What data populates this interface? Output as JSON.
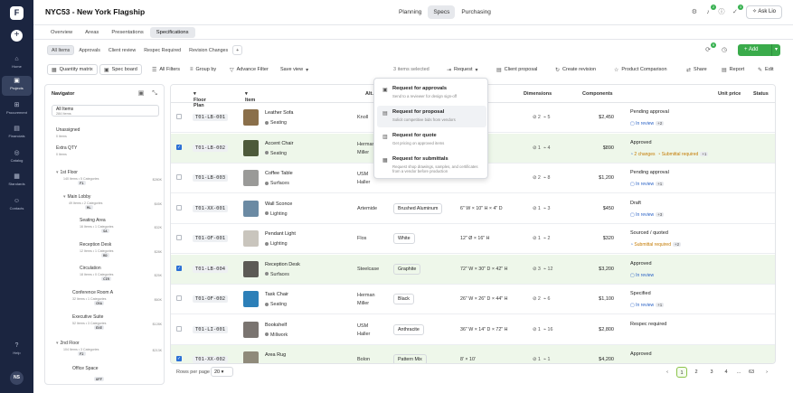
{
  "app": {
    "project_title": "NYC53 - New York Flagship",
    "tabs": [
      "Planning",
      "Specs",
      "Purchasing"
    ],
    "ask": "Ask Lio"
  },
  "rail": {
    "items": [
      "Home",
      "Projects",
      "Procurement",
      "Financials",
      "Catalog",
      "Standards",
      "Contacts"
    ],
    "help": "Help",
    "avatar": "NS"
  },
  "subtabs": [
    "Overview",
    "Areas",
    "Presentations",
    "Specifications"
  ],
  "filter_tabs": [
    "All Items",
    "Approvals",
    "Client review",
    "Respec Required",
    "Revision Changes",
    "+"
  ],
  "add_label": "+ Add",
  "badges": {
    "h1": "2",
    "h2": "3",
    "sync": "8"
  },
  "toolbar": {
    "quantity": "Quantity matrix",
    "spec_board": "Spec board",
    "all_filters": "All Filters",
    "group_by": "Group by",
    "advance_filter": "Advance Filter",
    "save_view": "Save view",
    "selected": "3 items selected",
    "request": "Request",
    "client_proposal": "Client proposal",
    "create_revision": "Create revision",
    "product_comparison": "Product Comparison",
    "share": "Share",
    "report": "Report",
    "edit": "Edit"
  },
  "navigator": {
    "title": "Navigator",
    "all_items": "All Items",
    "all_count": "284 Items",
    "unassigned": "Unassigned",
    "unassigned_count": "0 Items",
    "extra": "Extra QTY",
    "extra_count": "0 Items",
    "nodes": [
      {
        "code": "F1",
        "name": "1st Floor",
        "meta": "140 Items  •  5 Categories",
        "amount": "$280K"
      },
      {
        "code": "ML",
        "name": "Main Lobby",
        "meta": "49 Items  •  2 Categories",
        "amount": "$45K"
      },
      {
        "code": "SA",
        "name": "Seating Area",
        "meta": "16 Items  •  1 Categories",
        "amount": "$32K"
      },
      {
        "code": "RD",
        "name": "Reception Desk",
        "meta": "12 Items  •  1 Categories",
        "amount": "$28K"
      },
      {
        "code": "CIR",
        "name": "Circulation",
        "meta": "18 Items  •  0 Categories",
        "amount": "$25K"
      },
      {
        "code": "CRA",
        "name": "Conference Room A",
        "meta": "32 Items  •  1 Categories",
        "amount": "$60K"
      },
      {
        "code": "EXE",
        "name": "Executive Suite",
        "meta": "52 Items  •  3 Categories",
        "amount": "$128K"
      },
      {
        "code": "F2",
        "name": "2nd Floor",
        "meta": "104 Items  •  3 Categories",
        "amount": "$213K"
      },
      {
        "code": "OFF",
        "name": "Office Space",
        "meta": "",
        "amount": ""
      }
    ]
  },
  "columns": [
    "Floor Plan",
    "Item",
    "Alt.",
    "Dimensions",
    "Components",
    "Unit price",
    "Status"
  ],
  "rows": [
    {
      "checked": false,
      "code": "T01-LB-001",
      "name": "Leather Sofa",
      "cat": "Seating",
      "mfr": "Knoll",
      "finish": "",
      "dim": "\" W × 32\" H",
      "c1": "2",
      "c2": "5",
      "price": "$2,450",
      "status": "Pending approval",
      "pill": "In review",
      "extra": "+2",
      "hl": false,
      "thumb": "#8a6f4a"
    },
    {
      "checked": true,
      "code": "T01-LB-002",
      "name": "Accent Chair",
      "cat": "Seating",
      "mfr": "Herman Miller",
      "finish": "",
      "dim": "\" W × 34\" H",
      "c1": "1",
      "c2": "4",
      "price": "$890",
      "status": "Approved",
      "pill": "2 changes",
      "pill2": "Submittal required",
      "extra": "+1",
      "hl": true,
      "thumb": "#4d5a3a"
    },
    {
      "checked": false,
      "code": "T01-LB-003",
      "name": "Coffee Table",
      "cat": "Surfaces",
      "mfr": "USM Haller",
      "finish": "",
      "dim": "\" × 18\" H",
      "c1": "2",
      "c2": "8",
      "price": "$1,200",
      "status": "Pending approval",
      "pill": "In review",
      "extra": "+1",
      "hl": false,
      "thumb": "#9a9a98"
    },
    {
      "checked": false,
      "code": "T01-XX-001",
      "name": "Wall Sconce",
      "cat": "Lighting",
      "mfr": "Artemide",
      "finish": "Brushed Aluminum",
      "dim": "6\" W × 10\" H × 4\" D",
      "c1": "1",
      "c2": "3",
      "price": "$450",
      "status": "Draft",
      "pill": "In review",
      "extra": "+3",
      "hl": false,
      "thumb": "#6b8aa3"
    },
    {
      "checked": false,
      "code": "T01-OF-001",
      "name": "Pendant Light",
      "cat": "Lighting",
      "mfr": "Flos",
      "finish": "White",
      "dim": "12\" Ø × 16\" H",
      "c1": "1",
      "c2": "2",
      "price": "$320",
      "status": "Sourced / quoted",
      "pill": "Submittal required",
      "extra": "+2",
      "hl": false,
      "thumb": "#c9c5bd"
    },
    {
      "checked": true,
      "code": "T01-LB-004",
      "name": "Reception Desk",
      "cat": "Surfaces",
      "mfr": "Steelcase",
      "finish": "Graphite",
      "dim": "72\" W × 30\" D × 42\" H",
      "c1": "3",
      "c2": "12",
      "price": "$3,200",
      "status": "Approved",
      "pill": "In review",
      "extra": "",
      "hl": true,
      "thumb": "#5c5a55"
    },
    {
      "checked": false,
      "code": "T01-OF-002",
      "name": "Task Chair",
      "cat": "Seating",
      "mfr": "Herman Miller",
      "finish": "Black",
      "dim": "26\" W × 26\" D × 44\" H",
      "c1": "2",
      "c2": "6",
      "price": "$1,100",
      "status": "Specified",
      "pill": "In review",
      "extra": "+1",
      "hl": false,
      "thumb": "#2c7fb8"
    },
    {
      "checked": false,
      "code": "T01-LI-001",
      "name": "Bookshelf",
      "cat": "Millwork",
      "mfr": "USM Haller",
      "finish": "Anthracite",
      "dim": "36\" W × 14\" D × 72\" H",
      "c1": "1",
      "c2": "16",
      "price": "$2,800",
      "status": "Respec required",
      "pill": "",
      "extra": "",
      "hl": false,
      "thumb": "#7a7470"
    },
    {
      "checked": true,
      "code": "T01-XX-002",
      "name": "Area Rug",
      "cat": "",
      "mfr": "Bolon",
      "finish": "Pattern Mix",
      "dim": "8' × 10'",
      "c1": "1",
      "c2": "1",
      "price": "$4,200",
      "status": "Approved",
      "pill": "",
      "extra": "",
      "hl": true,
      "thumb": "#8f8a7a"
    }
  ],
  "pagination": {
    "label": "Rows per page",
    "size": "20",
    "pages": [
      "1",
      "2",
      "3",
      "4",
      "…",
      "63"
    ]
  },
  "dropdown": [
    {
      "title": "Request for approvals",
      "desc": "Send to a reviewer for design sign-off"
    },
    {
      "title": "Request for proposal",
      "desc": "Solicit competitive bids from vendors"
    },
    {
      "title": "Request for quote",
      "desc": "Get pricing on approved items"
    },
    {
      "title": "Request for submittals",
      "desc": "Request shop drawings, samples, and certificates from a vendor before production"
    }
  ]
}
